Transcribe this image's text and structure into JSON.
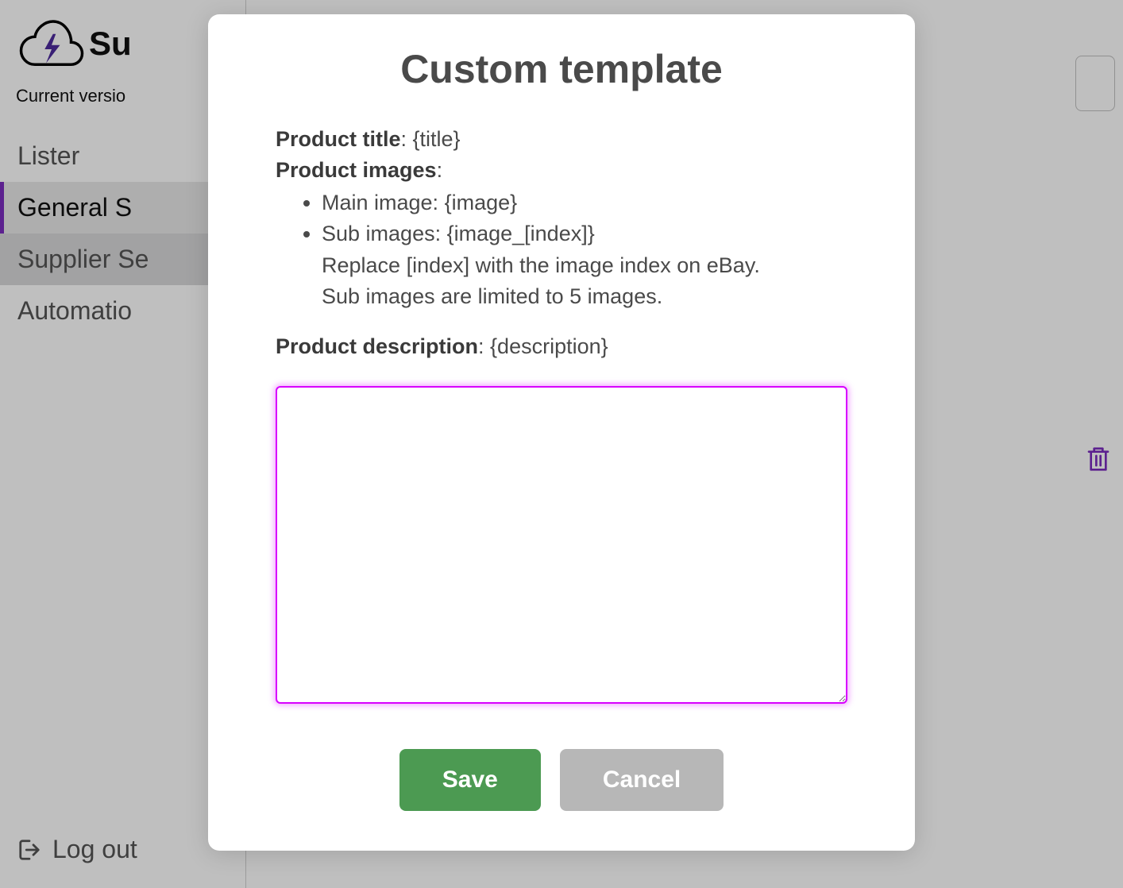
{
  "sidebar": {
    "logo_text_partial": "Su",
    "version_label_partial": "Current versio",
    "nav": [
      {
        "label": "Lister"
      },
      {
        "label": "General S"
      },
      {
        "label": "Supplier Se"
      },
      {
        "label": "Automatio"
      }
    ],
    "logout_label": "Log out"
  },
  "modal": {
    "title": "Custom template",
    "help": {
      "product_title_label": "Product title",
      "product_title_value": ": {title}",
      "product_images_label": "Product images",
      "product_images_colon": ":",
      "main_image_line": "Main image: {image}",
      "sub_images_line": "Sub images: {image_[index]}",
      "replace_note": "Replace [index] with the image index on eBay.",
      "limit_note": "Sub images are limited to 5 images.",
      "product_description_label": "Product description",
      "product_description_value": ": {description}"
    },
    "textarea_value": "",
    "save_label": "Save",
    "cancel_label": "Cancel"
  }
}
